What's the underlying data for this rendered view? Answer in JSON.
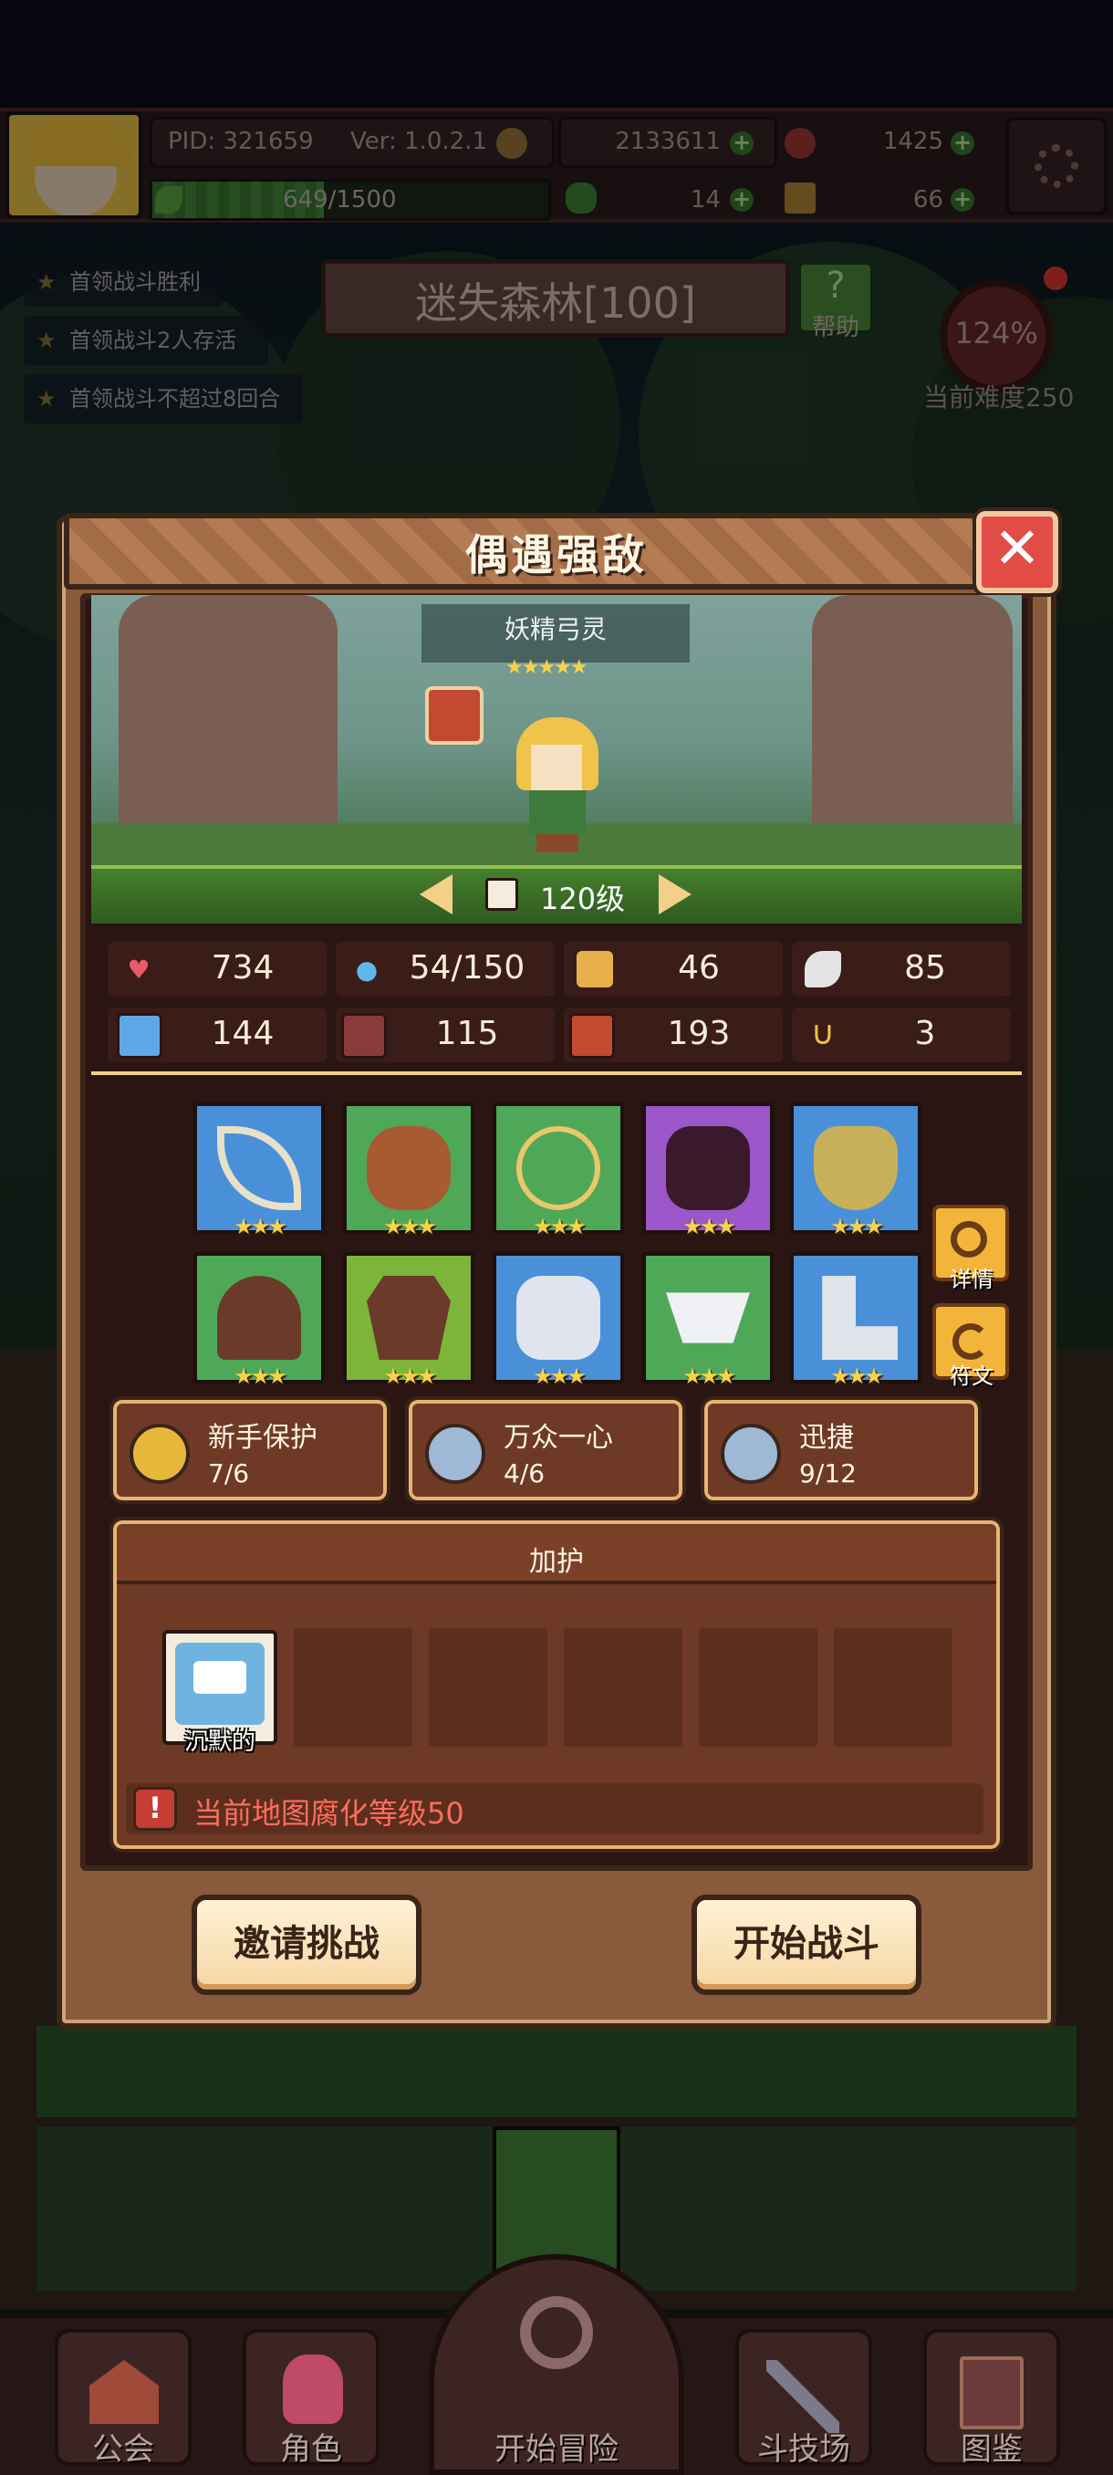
{
  "top_bar": {
    "pid": "PID: 321659",
    "version": "Ver: 1.0.2.1",
    "gold": "2133611",
    "gems": "1425",
    "xp": "649/1500",
    "xp_progress": 0.433,
    "clover": "14",
    "keys": "66"
  },
  "objectives": [
    "首领战斗胜利",
    "首领战斗2人存活",
    "首领战斗不超过8回合"
  ],
  "stage": {
    "name": "迷失森林[100]",
    "help_label": "帮助",
    "difficulty_percent": "124%",
    "difficulty_label": "当前难度250"
  },
  "modal": {
    "title": "偶遇强敌",
    "close_symbol": "✕",
    "enemy": {
      "name": "妖精弓灵",
      "stars": "★★★★★",
      "level": "120级"
    },
    "stats": [
      {
        "icon": "heart-icon",
        "value": "734"
      },
      {
        "icon": "mana-drop-icon",
        "value": "54/150"
      },
      {
        "icon": "shield-icon",
        "value": "46"
      },
      {
        "icon": "wing-icon",
        "value": "85"
      },
      {
        "icon": "fist-icon",
        "value": "144"
      },
      {
        "icon": "spellbook-icon",
        "value": "115"
      },
      {
        "icon": "magic-defense-icon",
        "value": "193"
      },
      {
        "icon": "horseshoe-icon",
        "value": "3"
      }
    ],
    "equipment_stars": "★★★",
    "equipment": [
      {
        "name": "bow",
        "color": "#4a90d9"
      },
      {
        "name": "wooden-shield",
        "color": "#4fa857"
      },
      {
        "name": "heart-amulet",
        "color": "#4fa857"
      },
      {
        "name": "dark-armor",
        "color": "#9b56c9"
      },
      {
        "name": "gold-ring",
        "color": "#4a90d9"
      },
      {
        "name": "leather-cap",
        "color": "#4fa857"
      },
      {
        "name": "leather-vest",
        "color": "#7cb53a"
      },
      {
        "name": "silver-gauntlet",
        "color": "#4a90d9"
      },
      {
        "name": "silver-belt",
        "color": "#4fa857"
      },
      {
        "name": "silver-boots",
        "color": "#4a90d9"
      }
    ],
    "side_buttons": {
      "details": "详情",
      "runes": "符文"
    },
    "set_bonuses": [
      {
        "name": "新手保护",
        "count": "7/6",
        "color": "#e6b73a"
      },
      {
        "name": "万众一心",
        "count": "4/6",
        "color": "#9fb8d6"
      },
      {
        "name": "迅捷",
        "count": "9/12",
        "color": "#9fb8d6"
      }
    ],
    "protection": {
      "title": "加护",
      "first_slot_label": "沉默的",
      "warning": "当前地图腐化等级50",
      "warning_symbol": "!"
    },
    "buttons": {
      "invite": "邀请挑战",
      "start": "开始战斗"
    }
  },
  "bottom_nav": [
    "公会",
    "角色",
    "开始冒险",
    "斗技场",
    "图鉴"
  ]
}
